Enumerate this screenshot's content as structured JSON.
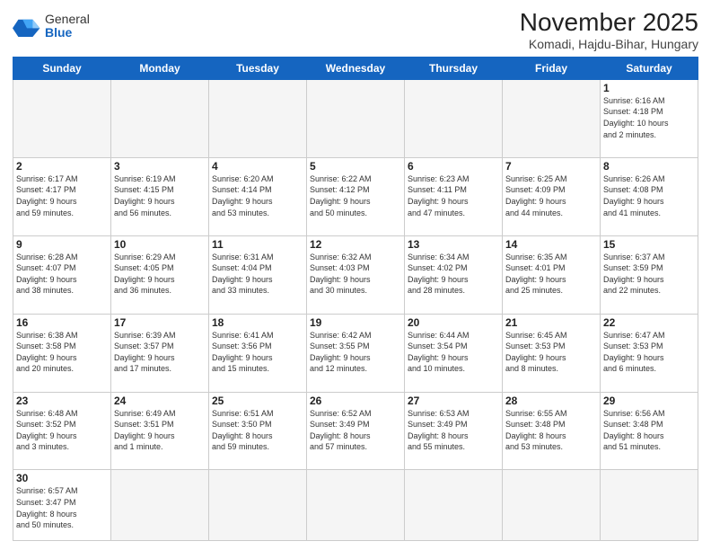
{
  "logo": {
    "line1": "General",
    "line2": "Blue"
  },
  "title": "November 2025",
  "subtitle": "Komadi, Hajdu-Bihar, Hungary",
  "weekdays": [
    "Sunday",
    "Monday",
    "Tuesday",
    "Wednesday",
    "Thursday",
    "Friday",
    "Saturday"
  ],
  "weeks": [
    [
      {
        "day": null,
        "info": null
      },
      {
        "day": null,
        "info": null
      },
      {
        "day": null,
        "info": null
      },
      {
        "day": null,
        "info": null
      },
      {
        "day": null,
        "info": null
      },
      {
        "day": null,
        "info": null
      },
      {
        "day": "1",
        "info": "Sunrise: 6:16 AM\nSunset: 4:18 PM\nDaylight: 10 hours\nand 2 minutes."
      }
    ],
    [
      {
        "day": "2",
        "info": "Sunrise: 6:17 AM\nSunset: 4:17 PM\nDaylight: 9 hours\nand 59 minutes."
      },
      {
        "day": "3",
        "info": "Sunrise: 6:19 AM\nSunset: 4:15 PM\nDaylight: 9 hours\nand 56 minutes."
      },
      {
        "day": "4",
        "info": "Sunrise: 6:20 AM\nSunset: 4:14 PM\nDaylight: 9 hours\nand 53 minutes."
      },
      {
        "day": "5",
        "info": "Sunrise: 6:22 AM\nSunset: 4:12 PM\nDaylight: 9 hours\nand 50 minutes."
      },
      {
        "day": "6",
        "info": "Sunrise: 6:23 AM\nSunset: 4:11 PM\nDaylight: 9 hours\nand 47 minutes."
      },
      {
        "day": "7",
        "info": "Sunrise: 6:25 AM\nSunset: 4:09 PM\nDaylight: 9 hours\nand 44 minutes."
      },
      {
        "day": "8",
        "info": "Sunrise: 6:26 AM\nSunset: 4:08 PM\nDaylight: 9 hours\nand 41 minutes."
      }
    ],
    [
      {
        "day": "9",
        "info": "Sunrise: 6:28 AM\nSunset: 4:07 PM\nDaylight: 9 hours\nand 38 minutes."
      },
      {
        "day": "10",
        "info": "Sunrise: 6:29 AM\nSunset: 4:05 PM\nDaylight: 9 hours\nand 36 minutes."
      },
      {
        "day": "11",
        "info": "Sunrise: 6:31 AM\nSunset: 4:04 PM\nDaylight: 9 hours\nand 33 minutes."
      },
      {
        "day": "12",
        "info": "Sunrise: 6:32 AM\nSunset: 4:03 PM\nDaylight: 9 hours\nand 30 minutes."
      },
      {
        "day": "13",
        "info": "Sunrise: 6:34 AM\nSunset: 4:02 PM\nDaylight: 9 hours\nand 28 minutes."
      },
      {
        "day": "14",
        "info": "Sunrise: 6:35 AM\nSunset: 4:01 PM\nDaylight: 9 hours\nand 25 minutes."
      },
      {
        "day": "15",
        "info": "Sunrise: 6:37 AM\nSunset: 3:59 PM\nDaylight: 9 hours\nand 22 minutes."
      }
    ],
    [
      {
        "day": "16",
        "info": "Sunrise: 6:38 AM\nSunset: 3:58 PM\nDaylight: 9 hours\nand 20 minutes."
      },
      {
        "day": "17",
        "info": "Sunrise: 6:39 AM\nSunset: 3:57 PM\nDaylight: 9 hours\nand 17 minutes."
      },
      {
        "day": "18",
        "info": "Sunrise: 6:41 AM\nSunset: 3:56 PM\nDaylight: 9 hours\nand 15 minutes."
      },
      {
        "day": "19",
        "info": "Sunrise: 6:42 AM\nSunset: 3:55 PM\nDaylight: 9 hours\nand 12 minutes."
      },
      {
        "day": "20",
        "info": "Sunrise: 6:44 AM\nSunset: 3:54 PM\nDaylight: 9 hours\nand 10 minutes."
      },
      {
        "day": "21",
        "info": "Sunrise: 6:45 AM\nSunset: 3:53 PM\nDaylight: 9 hours\nand 8 minutes."
      },
      {
        "day": "22",
        "info": "Sunrise: 6:47 AM\nSunset: 3:53 PM\nDaylight: 9 hours\nand 6 minutes."
      }
    ],
    [
      {
        "day": "23",
        "info": "Sunrise: 6:48 AM\nSunset: 3:52 PM\nDaylight: 9 hours\nand 3 minutes."
      },
      {
        "day": "24",
        "info": "Sunrise: 6:49 AM\nSunset: 3:51 PM\nDaylight: 9 hours\nand 1 minute."
      },
      {
        "day": "25",
        "info": "Sunrise: 6:51 AM\nSunset: 3:50 PM\nDaylight: 8 hours\nand 59 minutes."
      },
      {
        "day": "26",
        "info": "Sunrise: 6:52 AM\nSunset: 3:49 PM\nDaylight: 8 hours\nand 57 minutes."
      },
      {
        "day": "27",
        "info": "Sunrise: 6:53 AM\nSunset: 3:49 PM\nDaylight: 8 hours\nand 55 minutes."
      },
      {
        "day": "28",
        "info": "Sunrise: 6:55 AM\nSunset: 3:48 PM\nDaylight: 8 hours\nand 53 minutes."
      },
      {
        "day": "29",
        "info": "Sunrise: 6:56 AM\nSunset: 3:48 PM\nDaylight: 8 hours\nand 51 minutes."
      }
    ],
    [
      {
        "day": "30",
        "info": "Sunrise: 6:57 AM\nSunset: 3:47 PM\nDaylight: 8 hours\nand 50 minutes."
      },
      {
        "day": null,
        "info": null
      },
      {
        "day": null,
        "info": null
      },
      {
        "day": null,
        "info": null
      },
      {
        "day": null,
        "info": null
      },
      {
        "day": null,
        "info": null
      },
      {
        "day": null,
        "info": null
      }
    ]
  ]
}
